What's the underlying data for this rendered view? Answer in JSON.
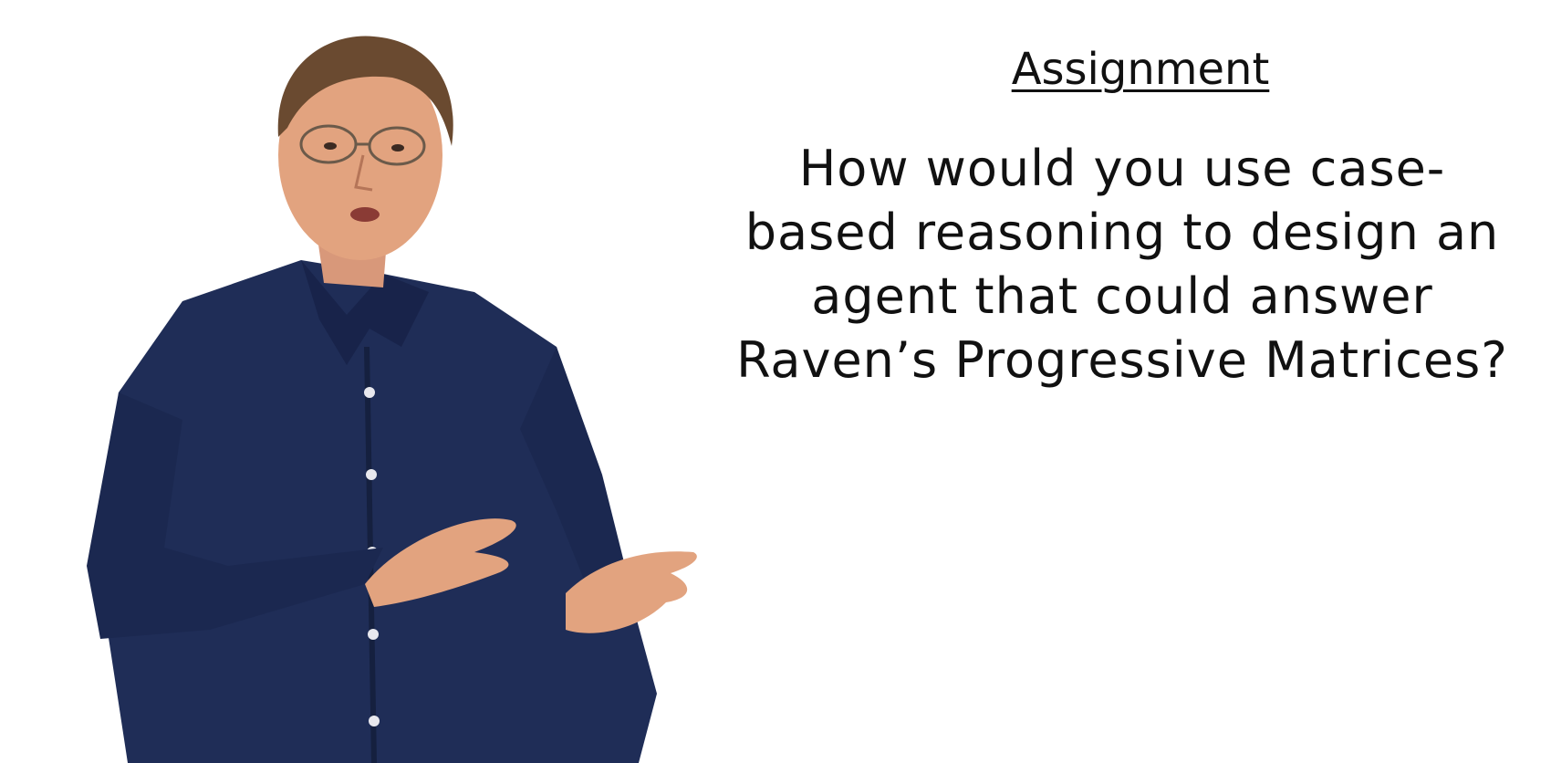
{
  "slide": {
    "title": "Assignment",
    "question_lines": [
      "How would you use case-",
      "based reasoning to design an",
      "agent that could answer",
      "Raven’s Progressive Matrices?"
    ]
  },
  "presenter": {
    "icon": "instructor-figure",
    "colors": {
      "shirt": "#1f2d57",
      "skin": "#e2a37f",
      "hair": "#6a4a30"
    }
  }
}
